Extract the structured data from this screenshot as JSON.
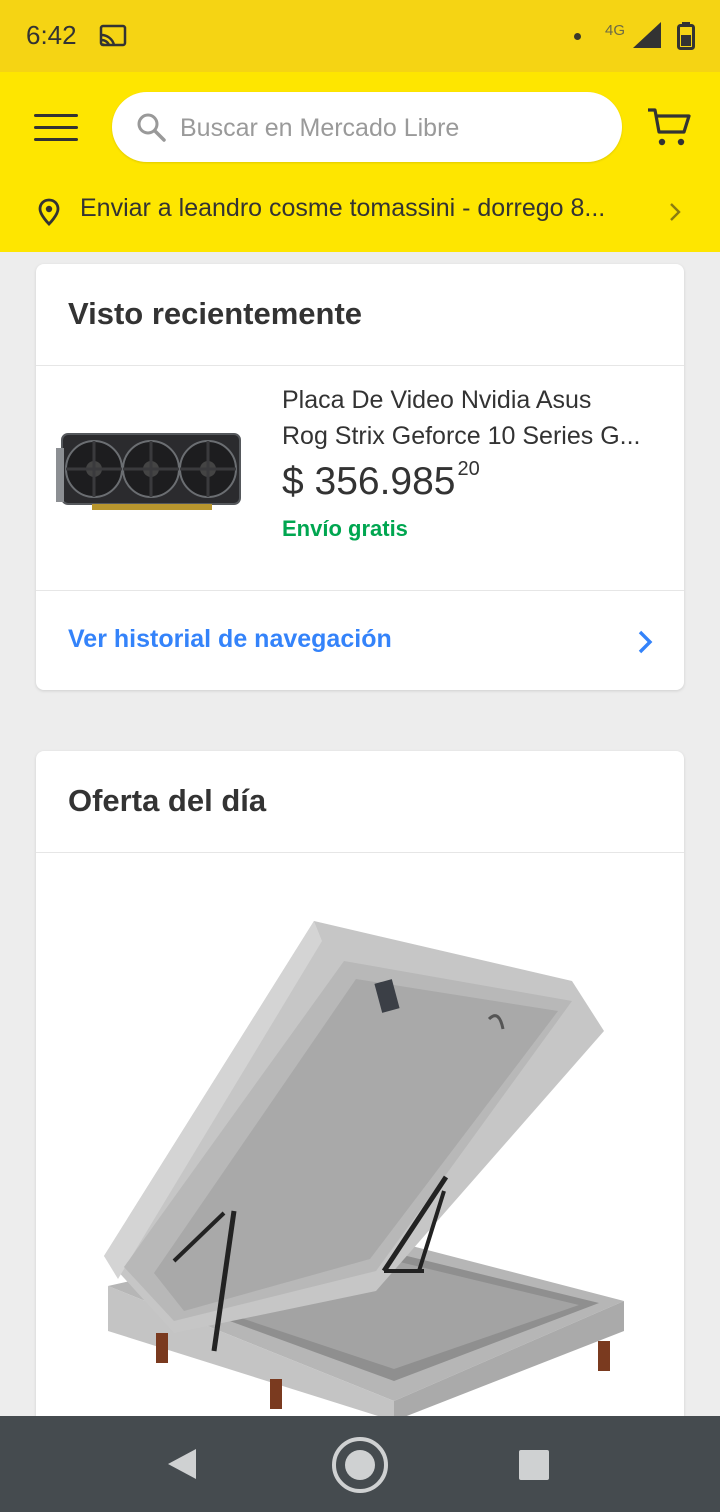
{
  "status_bar": {
    "time": "6:42",
    "network": "4G"
  },
  "header": {
    "search_placeholder": "Buscar en Mercado Libre",
    "address": "Enviar a leandro cosme tomassini - dorrego 8..."
  },
  "recent": {
    "title": "Visto recientemente",
    "product": {
      "title_line1": "Placa De Video Nvidia Asus",
      "title_line2": "Rog Strix Geforce 10 Series G...",
      "price": "$ 356.985",
      "price_cents": "20",
      "shipping": "Envío gratis"
    },
    "history_link": "Ver historial de navegación"
  },
  "deal": {
    "title": "Oferta del día"
  },
  "colors": {
    "brand_yellow": "#fee600",
    "link_blue": "#3483fa",
    "free_shipping_green": "#00a650"
  }
}
